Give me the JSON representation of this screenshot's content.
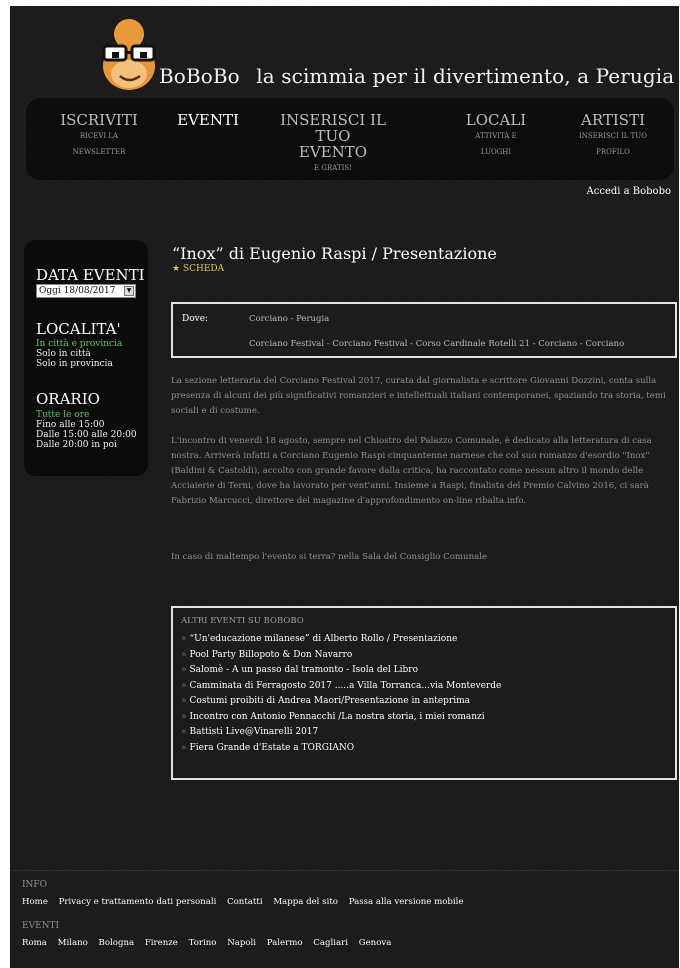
{
  "site": {
    "name": "BoBoBo",
    "tagline": "la scimmia per il divertimento, a Perugia"
  },
  "nav": [
    {
      "title": "ISCRIVITI",
      "sub": "RICEVI LA",
      "sub2": "NEWSLETTER"
    },
    {
      "title": "EVENTI",
      "sub": "",
      "sub2": ""
    },
    {
      "title": "INSERISCI IL TUO",
      "title2": "EVENTO",
      "sub": "E GRATIS!",
      "sub2": ""
    },
    {
      "title": "LOCALI",
      "sub": "ATTIVITÀ E",
      "sub2": "LUOGHI"
    },
    {
      "title": "ARTISTI",
      "sub": "INSERISCI IL TUO",
      "sub2": "PROFILO"
    }
  ],
  "login_link": "Accedi a Bobobo",
  "sidebar": {
    "date_heading": "DATA EVENTI",
    "date_value": "Oggi  18/08/2017",
    "localita_heading": "LOCALITA'",
    "localita_options": [
      "In città e provincia",
      "Solo in città",
      "Solo in provincia"
    ],
    "orario_heading": "ORARIO",
    "orario_options": [
      "Tutte le ore",
      "Fino alle 15:00",
      "Dalle 15:00 alle 20:00",
      "Dalle 20:00 in poi"
    ]
  },
  "event": {
    "title": "“Inox” di Eugenio Raspi / Presentazione",
    "scheda": "★ SCHEDA",
    "dove_label": "Dove:",
    "dove_city": "Corciano - Perugia",
    "dove_address": "Corciano Festival - Corciano Festival - Corso Cardinale Rotelli 21 - Corciano - Corciano",
    "paragraphs": [
      "La sezione letteraria del Corciano Festival 2017, curata dal giornalista e scrittore Giovanni Dozzini, conta sulla presenza di alcuni dei più significativi romanzieri e intellettuali italiani contemporanei, spaziando tra storia, temi sociali e di costume.",
      "L'incontro di venerdì 18 agosto, sempre nel Chiostro del Palazzo Comunale, è dedicato alla letteratura di casa nostra. Arriverà infatti a Corciano Eugenio Raspi cinquantenne narnese che col suo romanzo d'esordio \"Inox\" (Baldini & Castoldi), accolto con grande favore dalla critica, ha raccontato come nessun altro il mondo delle Acciaierie di Terni, dove ha lavorato per vent'anni. Insieme a Raspi, finalista del Premio Calvino 2016, ci sarà Fabrizio Marcucci, direttore del magazine d'approfondimento on-line ribalta.info.",
      "In caso di maltempo l'evento si terra? nella Sala del Consiglio Comunale"
    ]
  },
  "altri": {
    "title": "ALTRI EVENTI SU BOBOBO",
    "items": [
      "“Un'educazione milanese” di Alberto Rollo / Presentazione",
      "Pool Party Billopoto & Don Navarro",
      "Salomè - A un passo dal tramonto - Isola del Libro",
      "Camminata di Ferragosto 2017 .....a Villa Torranca...via Monteverde",
      "Costumi proibiti di Andrea Maori/Presentazione in anteprima",
      "Incontro con Antonio Pennacchi /La nostra storia, i miei romanzi",
      "Battisti Live@Vinarelli 2017",
      "Fiera Grande d'Estate a TORGIANO"
    ]
  },
  "footer": {
    "info_heading": "INFO",
    "info_links": [
      "Home",
      "Privacy e trattamento dati personali",
      "Contatti",
      "Mappa del sito",
      "Passa alla versione mobile"
    ],
    "eventi_heading": "EVENTI",
    "city_links": [
      "Roma",
      "Milano",
      "Bologna",
      "Firenze",
      "Torino",
      "Napoli",
      "Palermo",
      "Cagliari",
      "Genova"
    ]
  }
}
